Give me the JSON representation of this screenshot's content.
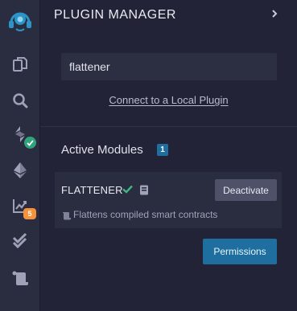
{
  "icon_panel": {
    "items": [
      {
        "icon": "remix-logo-icon"
      },
      {
        "icon": "file-explorer-icon"
      },
      {
        "icon": "search-icon"
      },
      {
        "icon": "solidity-compiler-icon",
        "badge": "check"
      },
      {
        "icon": "ethereum-deploy-icon"
      },
      {
        "icon": "analysis-chart-icon",
        "badge_count": "5"
      },
      {
        "icon": "double-check-icon"
      },
      {
        "icon": "scroll-icon"
      }
    ],
    "colors": {
      "badge_ok": "#2fa37a",
      "badge_count": "#f5933b"
    }
  },
  "plugin_manager": {
    "title": "PLUGIN MANAGER",
    "search": {
      "value": "flattener",
      "placeholder": ""
    },
    "connect_link": "Connect to a Local Plugin",
    "active_modules": {
      "label": "Active Modules",
      "count": "1",
      "plugins": [
        {
          "name": "FLATTENER",
          "verified": true,
          "deactivate_label": "Deactivate",
          "description": "Flattens compiled smart contracts"
        }
      ]
    },
    "permissions_label": "Permissions",
    "colors": {
      "accent": "#1e6f9f",
      "background": "#222336",
      "card": "#2a2c3f"
    }
  }
}
